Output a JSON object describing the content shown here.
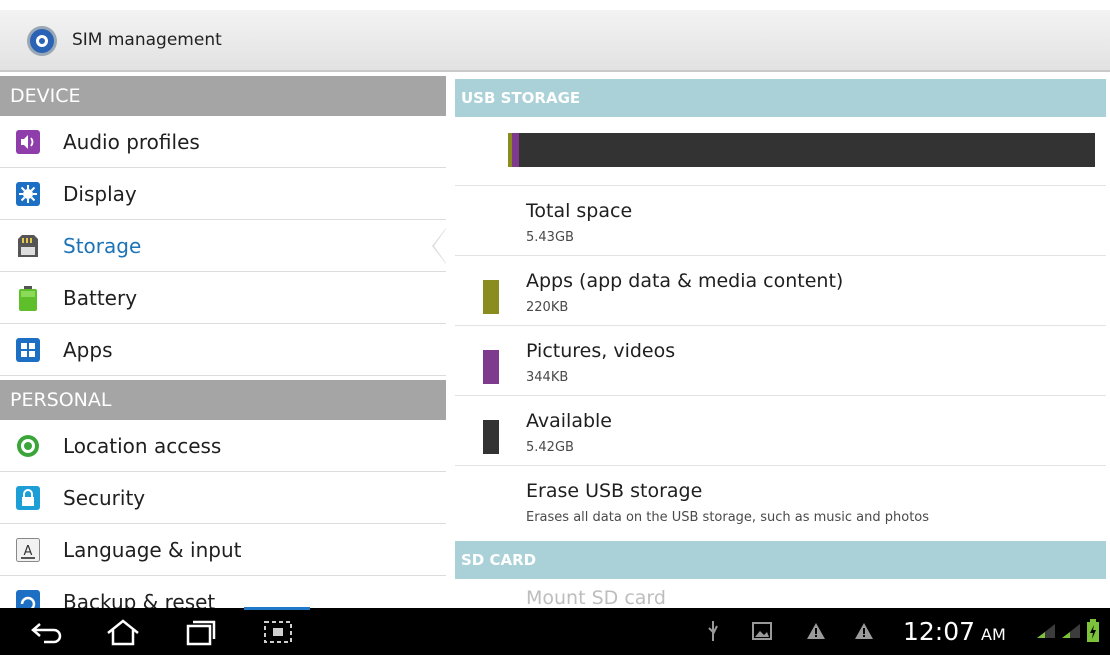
{
  "action_bar": {
    "title": "SIM management",
    "icon": "sim-management-icon"
  },
  "sidebar": {
    "sections": [
      {
        "label": "DEVICE"
      },
      {
        "label": "PERSONAL"
      }
    ],
    "items": [
      {
        "label": "Audio profiles",
        "icon": "audio-profiles-icon"
      },
      {
        "label": "Display",
        "icon": "display-icon"
      },
      {
        "label": "Storage",
        "icon": "storage-icon",
        "selected": true
      },
      {
        "label": "Battery",
        "icon": "battery-icon"
      },
      {
        "label": "Apps",
        "icon": "apps-icon"
      },
      {
        "label": "Location access",
        "icon": "location-icon"
      },
      {
        "label": "Security",
        "icon": "lock-icon"
      },
      {
        "label": "Language & input",
        "icon": "language-icon"
      },
      {
        "label": "Backup & reset",
        "icon": "backup-icon"
      }
    ]
  },
  "storage": {
    "usb_header": "USB STORAGE",
    "usage_bar_segments": [
      {
        "name": "Apps (app data & media content)",
        "color": "#8a8d1e"
      },
      {
        "name": "Pictures, videos",
        "color": "#7e3a8c"
      },
      {
        "name": "Available",
        "color": "#333333"
      }
    ],
    "rows": [
      {
        "title": "Total space",
        "value": "5.43GB"
      },
      {
        "title": "Apps (app data & media content)",
        "value": "220KB",
        "color": "#8a8d1e"
      },
      {
        "title": "Pictures, videos",
        "value": "344KB",
        "color": "#7e3a8c"
      },
      {
        "title": "Available",
        "value": "5.42GB",
        "color": "#333333"
      },
      {
        "title": "Erase USB storage",
        "value": "Erases all data on the USB storage, such as music and photos"
      }
    ],
    "sd_header": "SD CARD",
    "sd_rows": [
      {
        "title": "Mount SD card",
        "disabled": true
      }
    ]
  },
  "system_bar": {
    "time": "12:07",
    "ampm": "AM",
    "nav": [
      "back-icon",
      "home-icon",
      "recent-apps-icon",
      "screenshot-icon"
    ],
    "status": [
      "usb-icon",
      "image-icon",
      "warning-icon",
      "warning-icon",
      "signal-icon",
      "signal-icon",
      "battery-charging-icon"
    ]
  },
  "colors": {
    "accent": "#1c74b7",
    "section_left": "#a5a5a5",
    "section_right": "#a9d1d7"
  }
}
